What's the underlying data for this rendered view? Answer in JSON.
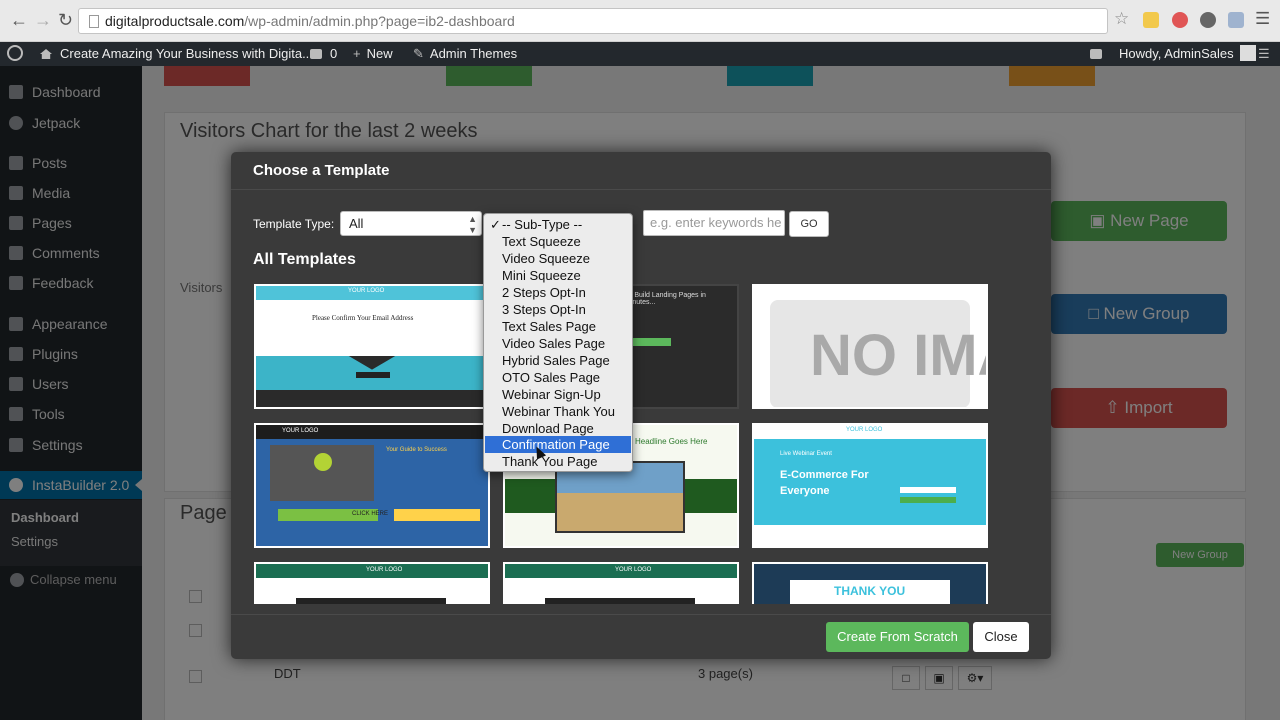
{
  "browser": {
    "url_host": "digitalproductsale.com",
    "url_path": "/wp-admin/admin.php?page=ib2-dashboard"
  },
  "admin_bar": {
    "site_name": "Create Amazing Your Business with Digita...",
    "comments_count": "0",
    "new_label": "New",
    "admin_themes_label": "Admin Themes",
    "howdy": "Howdy, AdminSales"
  },
  "sidebar": {
    "items": [
      {
        "label": "Dashboard"
      },
      {
        "label": "Jetpack"
      },
      {
        "label": "Posts"
      },
      {
        "label": "Media"
      },
      {
        "label": "Pages"
      },
      {
        "label": "Comments"
      },
      {
        "label": "Feedback"
      },
      {
        "label": "Appearance"
      },
      {
        "label": "Plugins"
      },
      {
        "label": "Users"
      },
      {
        "label": "Tools"
      },
      {
        "label": "Settings"
      },
      {
        "label": "InstaBuilder 2.0"
      }
    ],
    "submenu": [
      {
        "label": "Dashboard"
      },
      {
        "label": "Settings"
      }
    ],
    "collapse_label": "Collapse menu"
  },
  "background": {
    "chart_title": "Visitors Chart for the last 2 weeks",
    "visitors_label": "Visitors",
    "pages_title": "Page",
    "buttons": {
      "new_page": "New Page",
      "new_group": "New Group",
      "import": "Import"
    },
    "small_new_group": "New Group",
    "row_name": "DDT",
    "row_count": "3 page(s)",
    "colors": {
      "red": "#d9534f",
      "green": "#5cb85c",
      "blue": "#337ab7",
      "teal": "#1aa3b5",
      "orange": "#f0a030"
    }
  },
  "modal": {
    "title": "Choose a Template",
    "template_type_label": "Template Type:",
    "template_type_value": "All",
    "keyword_placeholder": "e.g. enter keywords he",
    "go_label": "GO",
    "section_title": "All Templates",
    "create_label": "Create From Scratch",
    "close_label": "Close",
    "thumbnails": [
      {
        "headline": "Please Confirm Your Email Address",
        "logo": "YOUR LOGO"
      },
      {
        "headline": "To Build Landing Pages in Minutes..."
      },
      {
        "headline": "NO IMAGE"
      },
      {
        "headline": "Your Guide to Success",
        "cta": "CLICK HERE",
        "logo": "YOUR LOGO"
      },
      {
        "headline": "Headline Goes Here"
      },
      {
        "headline": "E-Commerce For Everyone",
        "subline": "Live Webinar Event",
        "logo": "YOUR LOGO"
      },
      {
        "headline": "",
        "logo": "YOUR LOGO"
      },
      {
        "headline": "",
        "logo": "YOUR LOGO"
      },
      {
        "headline": "THANK YOU"
      }
    ]
  },
  "subtype_dropdown": {
    "options": [
      "-- Sub-Type --",
      "Text Squeeze",
      "Video Squeeze",
      "Mini Squeeze",
      "2 Steps Opt-In",
      "3 Steps Opt-In",
      "Text Sales Page",
      "Video Sales Page",
      "Hybrid Sales Page",
      "OTO Sales Page",
      "Webinar Sign-Up",
      "Webinar Thank You",
      "Download Page",
      "Confirmation Page",
      "Thank You Page"
    ],
    "checked_index": 0,
    "highlighted_index": 13
  }
}
